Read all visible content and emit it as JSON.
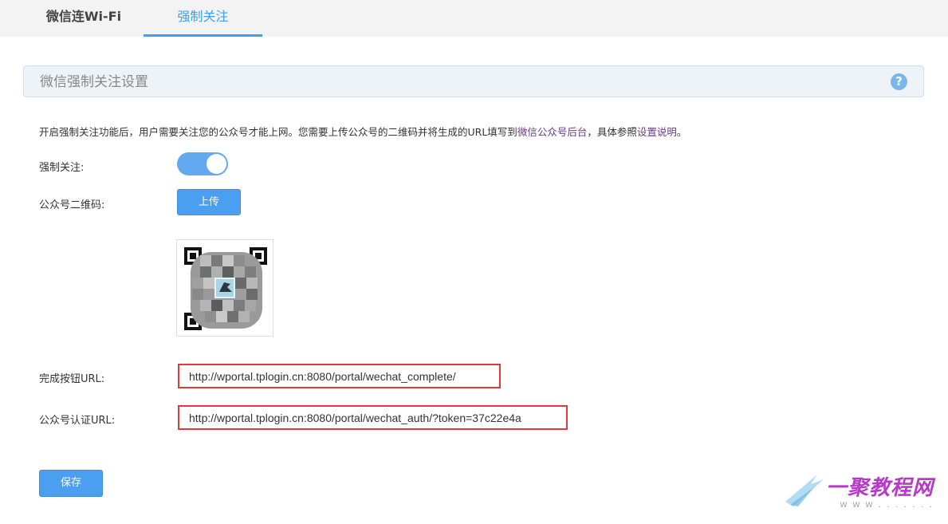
{
  "tabs": [
    {
      "label": "微信连Wi-Fi"
    },
    {
      "label": "强制关注"
    }
  ],
  "section": {
    "title": "微信强制关注设置",
    "help_icon": "?"
  },
  "description": {
    "text_before": "开启强制关注功能后，用户需要关注您的公众号才能上网。您需要上传公众号的二维码并将生成的URL填写到",
    "link1": "微信公众号后台",
    "text_middle": "，具体参照",
    "link2": "设置说明",
    "text_after": "。"
  },
  "form": {
    "force_follow_label": "强制关注:",
    "force_follow_on": true,
    "qr_label": "公众号二维码:",
    "upload_label": "上传",
    "complete_url_label": "完成按钮URL:",
    "complete_url_value": "http://wportal.tplogin.cn:8080/portal/wechat_complete/",
    "auth_url_label": "公众号认证URL:",
    "auth_url_value": "http://wportal.tplogin.cn:8080/portal/wechat_auth/?token=37c22e4a",
    "save_label": "保存"
  },
  "watermark": {
    "text": "一聚教程网",
    "sub": "w w w . . . . . . ."
  },
  "colors": {
    "accent": "#3aa0f0",
    "button": "#4a9ff0",
    "highlight": "#e03a3a"
  }
}
